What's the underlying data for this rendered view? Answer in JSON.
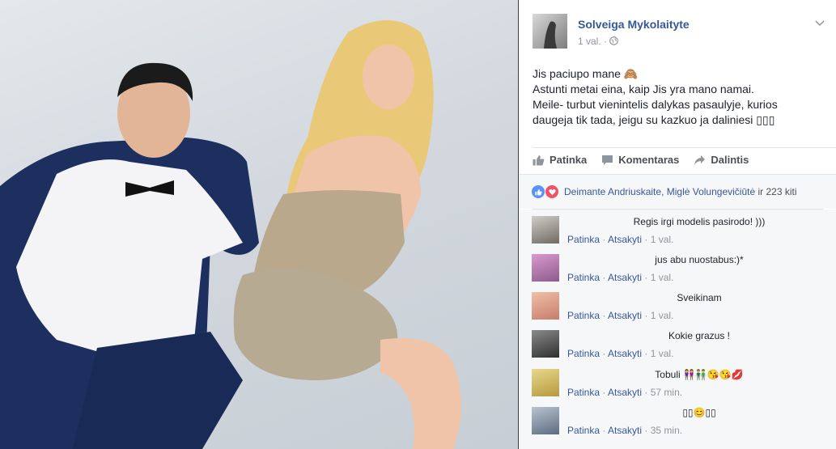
{
  "post": {
    "author": "Solveiga Mykolaityte",
    "time": "1 val. ·",
    "privacy_icon": "globe-icon",
    "text_lines": [
      "Jis paciupo mane 🙈",
      "Astunti metai eina, kaip Jis yra mano namai.",
      "Meile- turbut vienintelis dalykas pasaulyje, kurios",
      "daugeja tik tada, jeigu su kazkuo ja daliniesi ▯▯▯"
    ]
  },
  "actions": {
    "like": "Patinka",
    "comment": "Komentaras",
    "share": "Dalintis"
  },
  "reactions": {
    "names": "Deimante Andriuskaite, Miglė Volungevičiūtė",
    "rest": " ir 223 kiti"
  },
  "comments": [
    {
      "text": "Regis irgi modelis pasirodo! )))",
      "like": "Patinka",
      "reply": "Atsakyti",
      "time": "· 1 val.",
      "avatar_color": "#6f6a63"
    },
    {
      "text": "jus abu nuostabus:)*",
      "like": "Patinka",
      "reply": "Atsakyti",
      "time": "· 1 val.",
      "avatar_color": "#8d5a8b"
    },
    {
      "text": "Sveikinam",
      "like": "Patinka",
      "reply": "Atsakyti",
      "time": "· 1 val.",
      "avatar_color": "#c77c6a"
    },
    {
      "text": "Kokie grazus !",
      "like": "Patinka",
      "reply": "Atsakyti",
      "time": "· 1 val.",
      "avatar_color": "#2f2f2f"
    },
    {
      "text": "Tobuli 👭👬😘😘💋",
      "like": "Patinka",
      "reply": "Atsakyti",
      "time": "· 57 min.",
      "avatar_color": "#b59a3e"
    },
    {
      "text": "▯▯😊▯▯",
      "like": "Patinka",
      "reply": "Atsakyti",
      "time": "· 35 min.",
      "avatar_color": "#5b6b80"
    }
  ],
  "colors": {
    "link": "#365899",
    "like_blue": "#5890ff",
    "love_red": "#f25268"
  }
}
